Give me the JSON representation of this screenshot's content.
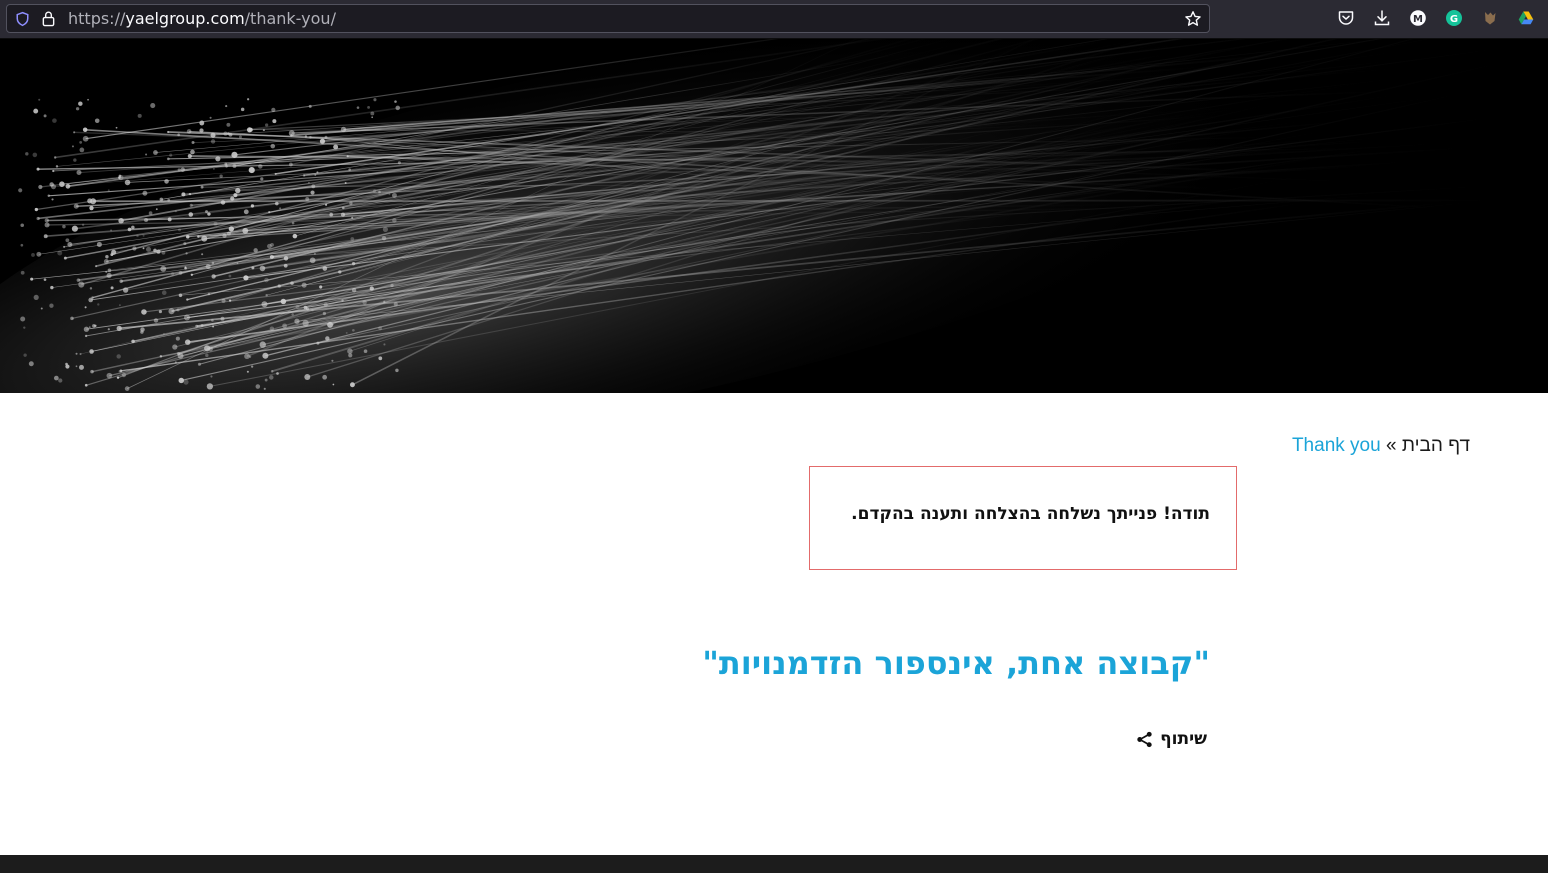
{
  "browser": {
    "url_prefix": "https://",
    "url_host": "yaelgroup.com",
    "url_path": "/thank-you/",
    "toolbar_icons": [
      "pocket-icon",
      "download-icon",
      "m-extension-icon",
      "grammarly-icon",
      "fox-extension-icon",
      "drive-icon"
    ]
  },
  "hero": {
    "description_icon": "fiber-optic-image"
  },
  "breadcrumb": {
    "home": "דף הבית",
    "separator": "»",
    "current": "Thank you"
  },
  "notice": {
    "text": "תודה! פנייתך נשלחה בהצלחה ותענה בהקדם."
  },
  "headline": {
    "text": "\"קבוצה אחת, אינספור הזדמנויות\""
  },
  "share": {
    "label": "שיתוף"
  },
  "colors": {
    "accent": "#1ba4d8",
    "notice_border": "#e36b6b",
    "toolbar_bg": "#2b2a33"
  }
}
